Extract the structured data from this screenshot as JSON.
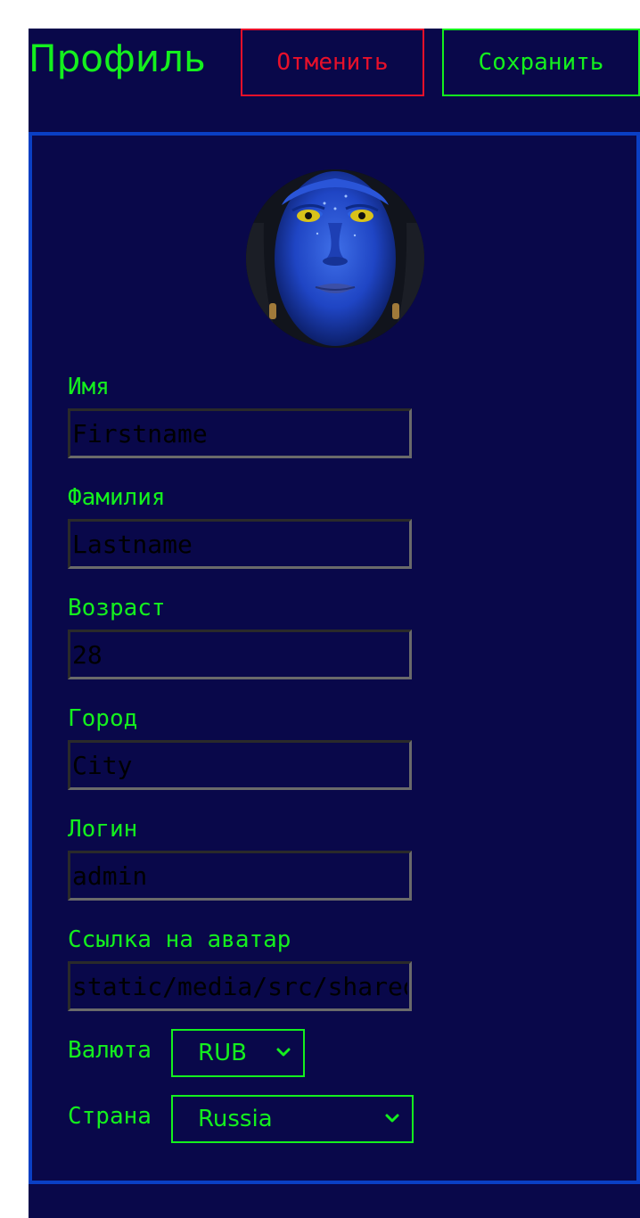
{
  "header": {
    "title": "Профиль",
    "cancel_label": "Отменить",
    "save_label": "Сохранить"
  },
  "form": {
    "firstname": {
      "label": "Имя",
      "placeholder": "Firstname"
    },
    "lastname": {
      "label": "Фамилия",
      "placeholder": "Lastname"
    },
    "age": {
      "label": "Возраст",
      "value": "28"
    },
    "city": {
      "label": "Город",
      "placeholder": "City"
    },
    "username": {
      "label": "Логин",
      "value": "admin"
    },
    "avatar_url": {
      "label": "Ссылка на аватар",
      "value": "static/media/src/shared/assets/tests/storybook.jpg"
    },
    "currency": {
      "label": "Валюта",
      "value": "RUB"
    },
    "country": {
      "label": "Страна",
      "value": "Russia"
    }
  },
  "icons": {
    "select_arrow": "chevron-down-icon",
    "avatar": "avatar-image"
  },
  "colors": {
    "background": "#09084a",
    "accent": "#14f01e",
    "danger": "#e8102a",
    "card_border": "#0a3fc4"
  }
}
